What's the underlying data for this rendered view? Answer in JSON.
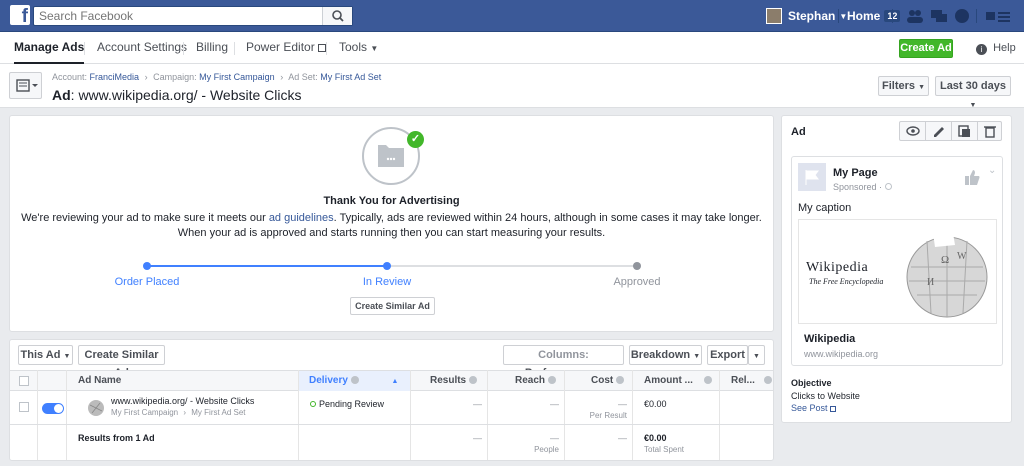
{
  "topbar": {
    "search_placeholder": "Search Facebook",
    "user_name": "Stephan",
    "home_label": "Home",
    "home_count": "12"
  },
  "nav": {
    "manage_ads": "Manage Ads",
    "account_settings": "Account Settings",
    "billing": "Billing",
    "power_editor": "Power Editor",
    "tools": "Tools",
    "create_ad": "Create Ad",
    "help": "Help"
  },
  "header": {
    "account_label": "Account:",
    "account_value": "FranciMedia",
    "campaign_label": "Campaign:",
    "campaign_value": "My First Campaign",
    "adset_label": "Ad Set:",
    "adset_value": "My First Ad Set",
    "title_prefix": "Ad",
    "title_rest": ": www.wikipedia.org/ - Website Clicks",
    "filters": "Filters",
    "date_range": "Last 30 days"
  },
  "review": {
    "title": "Thank You for Advertising",
    "text1": "We're reviewing your ad to make sure it meets our",
    "link": "ad guidelines",
    "text2": ". Typically, ads are reviewed within 24 hours, although in some cases it may take longer.",
    "text3": "When your ad is approved and starts running then you can start measuring your results.",
    "step1": "Order Placed",
    "step2": "In Review",
    "step3": "Approved",
    "similar_btn": "Create Similar Ad"
  },
  "table": {
    "this_ad": "This Ad",
    "create_similar": "Create Similar Ad",
    "columns": "Columns:",
    "columns_value": "Performance",
    "breakdown": "Breakdown",
    "export": "Export",
    "headers": {
      "ad_name": "Ad Name",
      "delivery": "Delivery",
      "results": "Results",
      "reach": "Reach",
      "cost": "Cost",
      "amount": "Amount ...",
      "rel": "Rel..."
    },
    "row": {
      "name": "www.wikipedia.org/ - Website Clicks",
      "campaign": "My First Campaign",
      "adset": "My First Ad Set",
      "delivery": "Pending Review",
      "results": "—",
      "reach": "—",
      "cost": "—",
      "cost_sub": "Per Result",
      "amount": "€0.00"
    },
    "total": {
      "label": "Results from 1 Ad",
      "results": "—",
      "reach": "—",
      "reach_sub": "People",
      "cost": "—",
      "amount": "€0.00",
      "amount_sub": "Total Spent"
    }
  },
  "preview": {
    "panel_title": "Ad",
    "page_name": "My Page",
    "sponsored": "Sponsored ·",
    "caption": "My caption",
    "wiki_title": "Wikipedia",
    "wiki_sub": "The Free Encyclopedia",
    "link_title": "Wikipedia",
    "link_url": "www.wikipedia.org",
    "objective_label": "Objective",
    "objective_value": "Clicks to Website",
    "see_post": "See Post"
  },
  "colors": {
    "brand": "#3b5998",
    "accent": "#4080ff",
    "green": "#42b72a"
  }
}
